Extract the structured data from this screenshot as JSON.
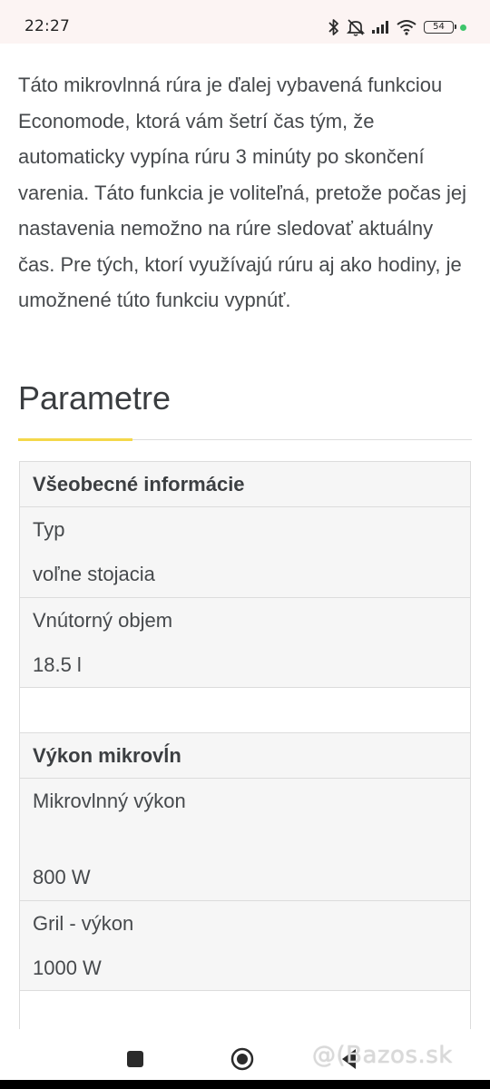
{
  "status_bar": {
    "time": "22:27",
    "battery": "54",
    "icons": [
      "bluetooth-icon",
      "muted-vibrate-icon",
      "signal-icon",
      "wifi-icon",
      "battery-icon",
      "charging-dot-icon"
    ]
  },
  "intro_text": "Táto mikrovlnná rúra je ďalej vybavená funkciou Economode, ktorá vám šetrí čas tým, že automaticky vypína rúru 3 minúty po skončení varenia. Táto funkcia je voliteľná, pretože počas jej nastavenia nemožno na rúre sledovať aktuálny čas. Pre tých, ktorí využívajú rúru aj ako hodiny, je umožnené túto funkciu vypnúť.",
  "section_title": "Parametre",
  "params": {
    "group1": {
      "title": "Všeobecné informácie",
      "rows": [
        {
          "label": "Typ",
          "value": "voľne stojacia"
        },
        {
          "label": "Vnútorný objem",
          "value": "18.5 l"
        }
      ]
    },
    "group2": {
      "title": "Výkon mikrovĺn",
      "rows": [
        {
          "label": "Mikrovlnný výkon",
          "value": "800 W"
        },
        {
          "label": "Gril - výkon",
          "value": "1000 W"
        }
      ]
    }
  },
  "watermark": "@(Bazos.sk",
  "colors": {
    "accent": "#f4d84a",
    "status_bar_bg": "#fcf4f3",
    "table_row_bg": "#f6f6f6",
    "border": "#dcdcdc"
  }
}
